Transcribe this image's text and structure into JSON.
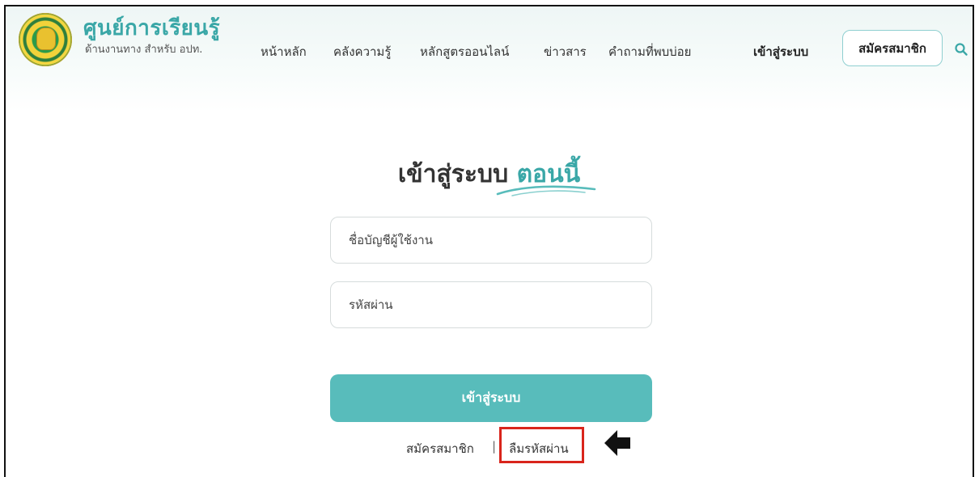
{
  "brand": {
    "title": "ศูนย์การเรียนรู้",
    "subtitle": "ด้านงานทาง สำหรับ อปท."
  },
  "nav": {
    "items": [
      {
        "label": "หน้าหลัก"
      },
      {
        "label": "คลังความรู้"
      },
      {
        "label": "หลักสูตรออนไลน์"
      },
      {
        "label": "ข่าวสาร"
      },
      {
        "label": "คำถามที่พบบ่อย"
      }
    ],
    "login_label": "เข้าสู่ระบบ",
    "register_label": "สมัครสมาชิก",
    "search_icon": "search-icon"
  },
  "login": {
    "heading": "เข้าสู่ระบบ",
    "heading_accent": "ตอนนี้",
    "username_placeholder": "ชื่อบัญชีผู้ใช้งาน",
    "password_placeholder": "รหัสผ่าน",
    "submit_label": "เข้าสู่ระบบ",
    "register_link": "สมัครสมาชิก",
    "separator": "|",
    "forgot_link": "ลืมรหัสผ่าน"
  },
  "annotation": {
    "arrow_icon": "left-arrow-icon",
    "highlight_color": "#d9251c"
  },
  "colors": {
    "accent": "#3aa7a7",
    "button": "#58bcbb"
  }
}
